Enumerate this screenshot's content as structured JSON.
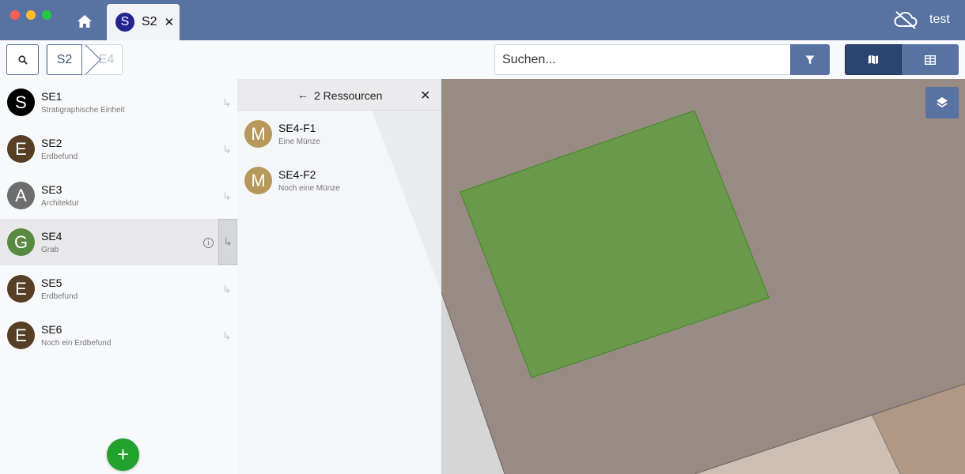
{
  "window": {
    "tab": {
      "avatar_letter": "S",
      "label": "S2",
      "close": "✕"
    },
    "user": "test",
    "icons": {
      "home": "home-icon",
      "cloud": "cloud-off-icon"
    }
  },
  "toolbar": {
    "breadcrumbs": [
      "S2",
      "SE4"
    ],
    "search_placeholder": "Suchen...",
    "icons": {
      "search": "search-icon",
      "filter": "filter-icon",
      "map_view": "map-icon",
      "table_view": "table-icon",
      "layers": "layers-icon"
    }
  },
  "resources": [
    {
      "letter": "S",
      "identifier": "SE1",
      "short_description": "Stratigraphische Einheit",
      "color": "#000000"
    },
    {
      "letter": "E",
      "identifier": "SE2",
      "short_description": "Erdbefund",
      "color": "#563f25"
    },
    {
      "letter": "A",
      "identifier": "SE3",
      "short_description": "Architektur",
      "color": "#6d6d6d"
    },
    {
      "letter": "G",
      "identifier": "SE4",
      "short_description": "Grab",
      "color": "#598a42",
      "selected": true
    },
    {
      "letter": "E",
      "identifier": "SE5",
      "short_description": "Erdbefund",
      "color": "#563f25"
    },
    {
      "letter": "E",
      "identifier": "SE6",
      "short_description": "Noch ein Erdbefund",
      "color": "#563f25"
    }
  ],
  "child_panel": {
    "title": "2 Ressourcen",
    "back": "←",
    "close": "✕",
    "items": [
      {
        "letter": "M",
        "identifier": "SE4-F1",
        "short_description": "Eine Münze",
        "color": "#b6985a"
      },
      {
        "letter": "M",
        "identifier": "SE4-F2",
        "short_description": "Noch eine Münze",
        "color": "#b6985a"
      }
    ]
  },
  "symbols": {
    "child_arrow": "↳",
    "add": "+",
    "info": "i"
  },
  "colors": {
    "accent": "#5872a2",
    "accent_dark": "#2c4470",
    "add_button": "#22a12e",
    "map_feature": "#6a994c",
    "map_background": "#978b84"
  }
}
